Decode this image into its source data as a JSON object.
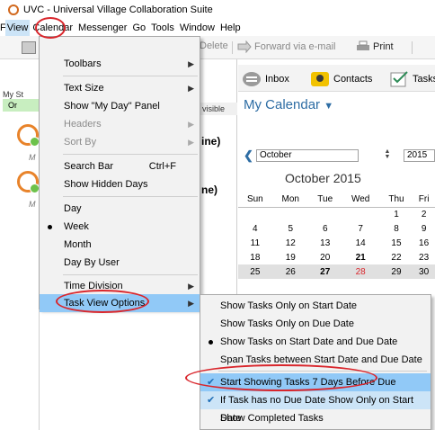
{
  "window": {
    "title": "UVC - Universal Village Collaboration Suite"
  },
  "menubar": [
    "File",
    "View",
    "Calendar",
    "Messenger",
    "Go",
    "Tools",
    "Window",
    "Help"
  ],
  "toolbar": {
    "delete": "Delete",
    "forward": "Forward via e-mail",
    "print": "Print"
  },
  "left_pane": {
    "label": "My St",
    "green": "Or",
    "letter": "M"
  },
  "mid_pane": {
    "visible": "visible",
    "line1": "ine)",
    "line2": "ne)"
  },
  "nav": {
    "inbox": "Inbox",
    "contacts": "Contacts",
    "tasks": "Tasks"
  },
  "calendar": {
    "heading": "My Calendar",
    "month_value": "October",
    "year_value": "2015",
    "title": "October 2015",
    "days": [
      "Sun",
      "Mon",
      "Tue",
      "Wed",
      "Thu",
      "Fri"
    ],
    "weeks": [
      [
        "",
        "",
        "",
        "",
        "1",
        "2"
      ],
      [
        "4",
        "5",
        "6",
        "7",
        "8",
        "9"
      ],
      [
        "11",
        "12",
        "13",
        "14",
        "15",
        "16"
      ],
      [
        "18",
        "19",
        "20",
        "21",
        "22",
        "23"
      ],
      [
        "25",
        "26",
        "27",
        "28",
        "29",
        "30"
      ]
    ]
  },
  "view_menu": {
    "toolbars": "Toolbars",
    "text_size": "Text Size",
    "show_my_day": "Show \"My Day\" Panel",
    "headers": "Headers",
    "sort_by": "Sort By",
    "search_bar": "Search Bar",
    "search_shortcut": "Ctrl+F",
    "show_hidden_days": "Show Hidden Days",
    "day": "Day",
    "week": "Week",
    "month": "Month",
    "day_by_user": "Day By User",
    "time_division": "Time Division",
    "task_view_options": "Task View Options"
  },
  "task_submenu": {
    "only_start": "Show Tasks Only on Start Date",
    "only_due": "Show Tasks Only on Due Date",
    "start_and_due": "Show Tasks on Start Date and Due Date",
    "span": "Span Tasks between Start Date and Due Date",
    "seven_days": "Start Showing Tasks 7 Days Before Due",
    "no_due": "If Task has no Due Date Show Only on Start Date",
    "completed": "Show Completed Tasks"
  },
  "colors": {
    "accent": "#2e6da4",
    "highlight": "#91c9f7",
    "annotation": "#d9262c"
  }
}
